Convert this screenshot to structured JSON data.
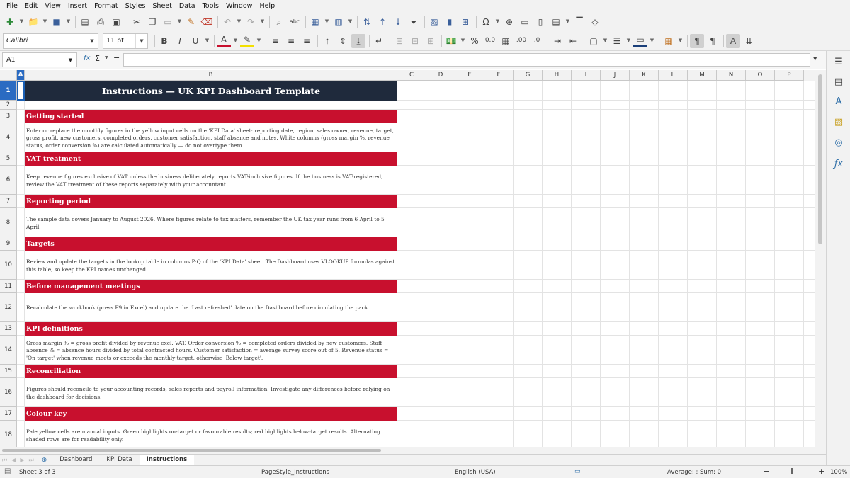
{
  "menu": [
    "File",
    "Edit",
    "View",
    "Insert",
    "Format",
    "Styles",
    "Sheet",
    "Data",
    "Tools",
    "Window",
    "Help"
  ],
  "toolbar": {
    "font_name": "Calibri",
    "font_size": "11 pt"
  },
  "formula_bar": {
    "name_box": "A1",
    "fx": "fx",
    "sum": "Σ",
    "equals": "=",
    "content": ""
  },
  "columns": [
    {
      "label": "A",
      "selected": true
    },
    {
      "label": "B"
    },
    {
      "label": "C"
    },
    {
      "label": "D"
    },
    {
      "label": "E"
    },
    {
      "label": "F"
    },
    {
      "label": "G"
    },
    {
      "label": "H"
    },
    {
      "label": "I"
    },
    {
      "label": "J"
    },
    {
      "label": "K"
    },
    {
      "label": "L"
    },
    {
      "label": "M"
    },
    {
      "label": "N"
    },
    {
      "label": "O"
    },
    {
      "label": "P"
    }
  ],
  "rows": [
    {
      "num": "1",
      "type": "title",
      "text": "Instructions — UK KPI Dashboard Template"
    },
    {
      "num": "2",
      "type": "empty",
      "text": ""
    },
    {
      "num": "3",
      "type": "header",
      "text": "Getting started"
    },
    {
      "num": "4",
      "type": "body",
      "text": "Enter or replace the monthly figures in the yellow input cells on the 'KPI Data' sheet: reporting date, region, sales owner, revenue, target, gross profit, new customers, completed orders, customer satisfaction, staff absence and notes. White columns (gross margin %, revenue status, order conversion %) are calculated automatically — do not overtype them."
    },
    {
      "num": "5",
      "type": "header",
      "text": "VAT treatment"
    },
    {
      "num": "6",
      "type": "body",
      "text": "Keep revenue figures exclusive of VAT unless the business deliberately reports VAT-inclusive figures. If the business is VAT-registered, review the VAT treatment of these reports separately with your accountant."
    },
    {
      "num": "7",
      "type": "header",
      "text": "Reporting period"
    },
    {
      "num": "8",
      "type": "body",
      "text": "The sample data covers January to August 2026. Where figures relate to tax matters, remember the UK tax year runs from 6 April to 5 April."
    },
    {
      "num": "9",
      "type": "header",
      "text": "Targets"
    },
    {
      "num": "10",
      "type": "body",
      "text": "Review and update the targets in the lookup table in columns P:Q of the 'KPI Data' sheet. The Dashboard uses VLOOKUP formulas against this table, so keep the KPI names unchanged."
    },
    {
      "num": "11",
      "type": "header",
      "text": "Before management meetings"
    },
    {
      "num": "12",
      "type": "body",
      "text": "Recalculate the workbook (press F9 in Excel) and update the 'Last refreshed' date on the Dashboard before circulating the pack."
    },
    {
      "num": "13",
      "type": "header",
      "text": "KPI definitions"
    },
    {
      "num": "14",
      "type": "body",
      "text": "Gross margin % = gross profit divided by revenue excl. VAT. Order conversion % = completed orders divided by new customers. Staff absence % = absence hours divided by total contracted hours. Customer satisfaction = average survey score out of 5. Revenue status = 'On target' when revenue meets or exceeds the monthly target, otherwise 'Below target'."
    },
    {
      "num": "15",
      "type": "header",
      "text": "Reconciliation"
    },
    {
      "num": "16",
      "type": "body",
      "text": "Figures should reconcile to your accounting records, sales reports and payroll information. Investigate any differences before relying on the dashboard for decisions."
    },
    {
      "num": "17",
      "type": "header",
      "text": "Colour key"
    },
    {
      "num": "18",
      "type": "body",
      "text": "Pale yellow cells are manual inputs. Green highlights on-target or favourable results; red highlights below-target results. Alternating shaded rows are for readability only."
    }
  ],
  "sheet_tabs": [
    {
      "label": "Dashboard",
      "active": false
    },
    {
      "label": "KPI Data",
      "active": false
    },
    {
      "label": "Instructions",
      "active": true
    }
  ],
  "status": {
    "sheet": "Sheet 3 of 3",
    "page_style": "PageStyle_Instructions",
    "language": "English (USA)",
    "sum": "Average: ; Sum: 0",
    "zoom": "100%"
  },
  "colors": {
    "title_bg": "#1f2a3c",
    "header_bg": "#c8102e",
    "selection": "#2a6bc2"
  }
}
